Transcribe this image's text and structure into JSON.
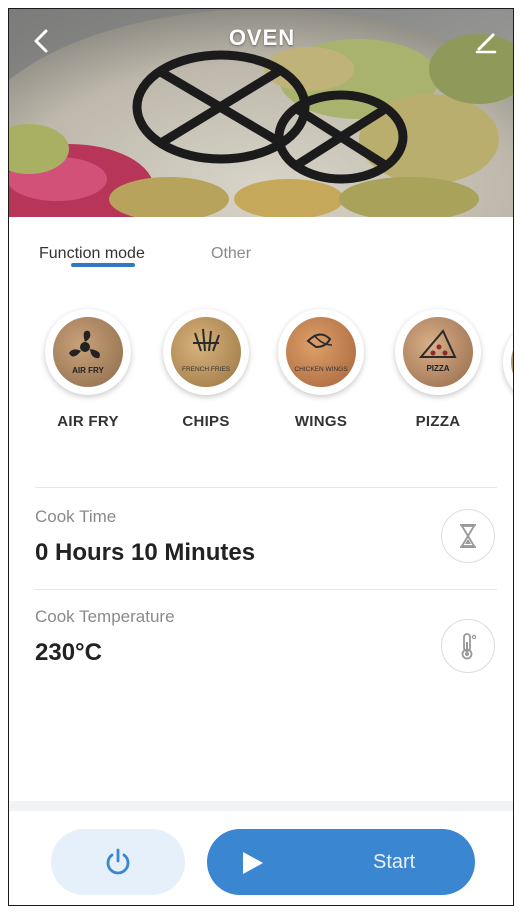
{
  "header": {
    "title": "OVEN",
    "back_icon": "chevron-left-icon",
    "edit_icon": "pencil-icon"
  },
  "tabs": [
    {
      "label": "Function mode",
      "active": true
    },
    {
      "label": "Other",
      "active": false
    }
  ],
  "modes": [
    {
      "label": "AIR FRY",
      "icon": "air-fry-icon",
      "badge": "AIR FRY"
    },
    {
      "label": "CHIPS",
      "icon": "chips-icon",
      "badge": "FRENCH FRIES"
    },
    {
      "label": "WINGS",
      "icon": "wings-icon",
      "badge": "CHICKEN WINGS"
    },
    {
      "label": "PIZZA",
      "icon": "pizza-icon",
      "badge": "PIZZA"
    }
  ],
  "cook_time": {
    "label": "Cook Time",
    "value": "0 Hours 10 Minutes",
    "icon": "hourglass-icon"
  },
  "cook_temperature": {
    "label": "Cook Temperature",
    "value": "230°C",
    "icon": "thermometer-icon"
  },
  "actions": {
    "power_icon": "power-icon",
    "start_label": "Start",
    "start_icon": "play-icon"
  },
  "colors": {
    "accent": "#3a86d0",
    "accent_light": "#e6f0fa",
    "tab_indicator": "#2e7bc4"
  }
}
